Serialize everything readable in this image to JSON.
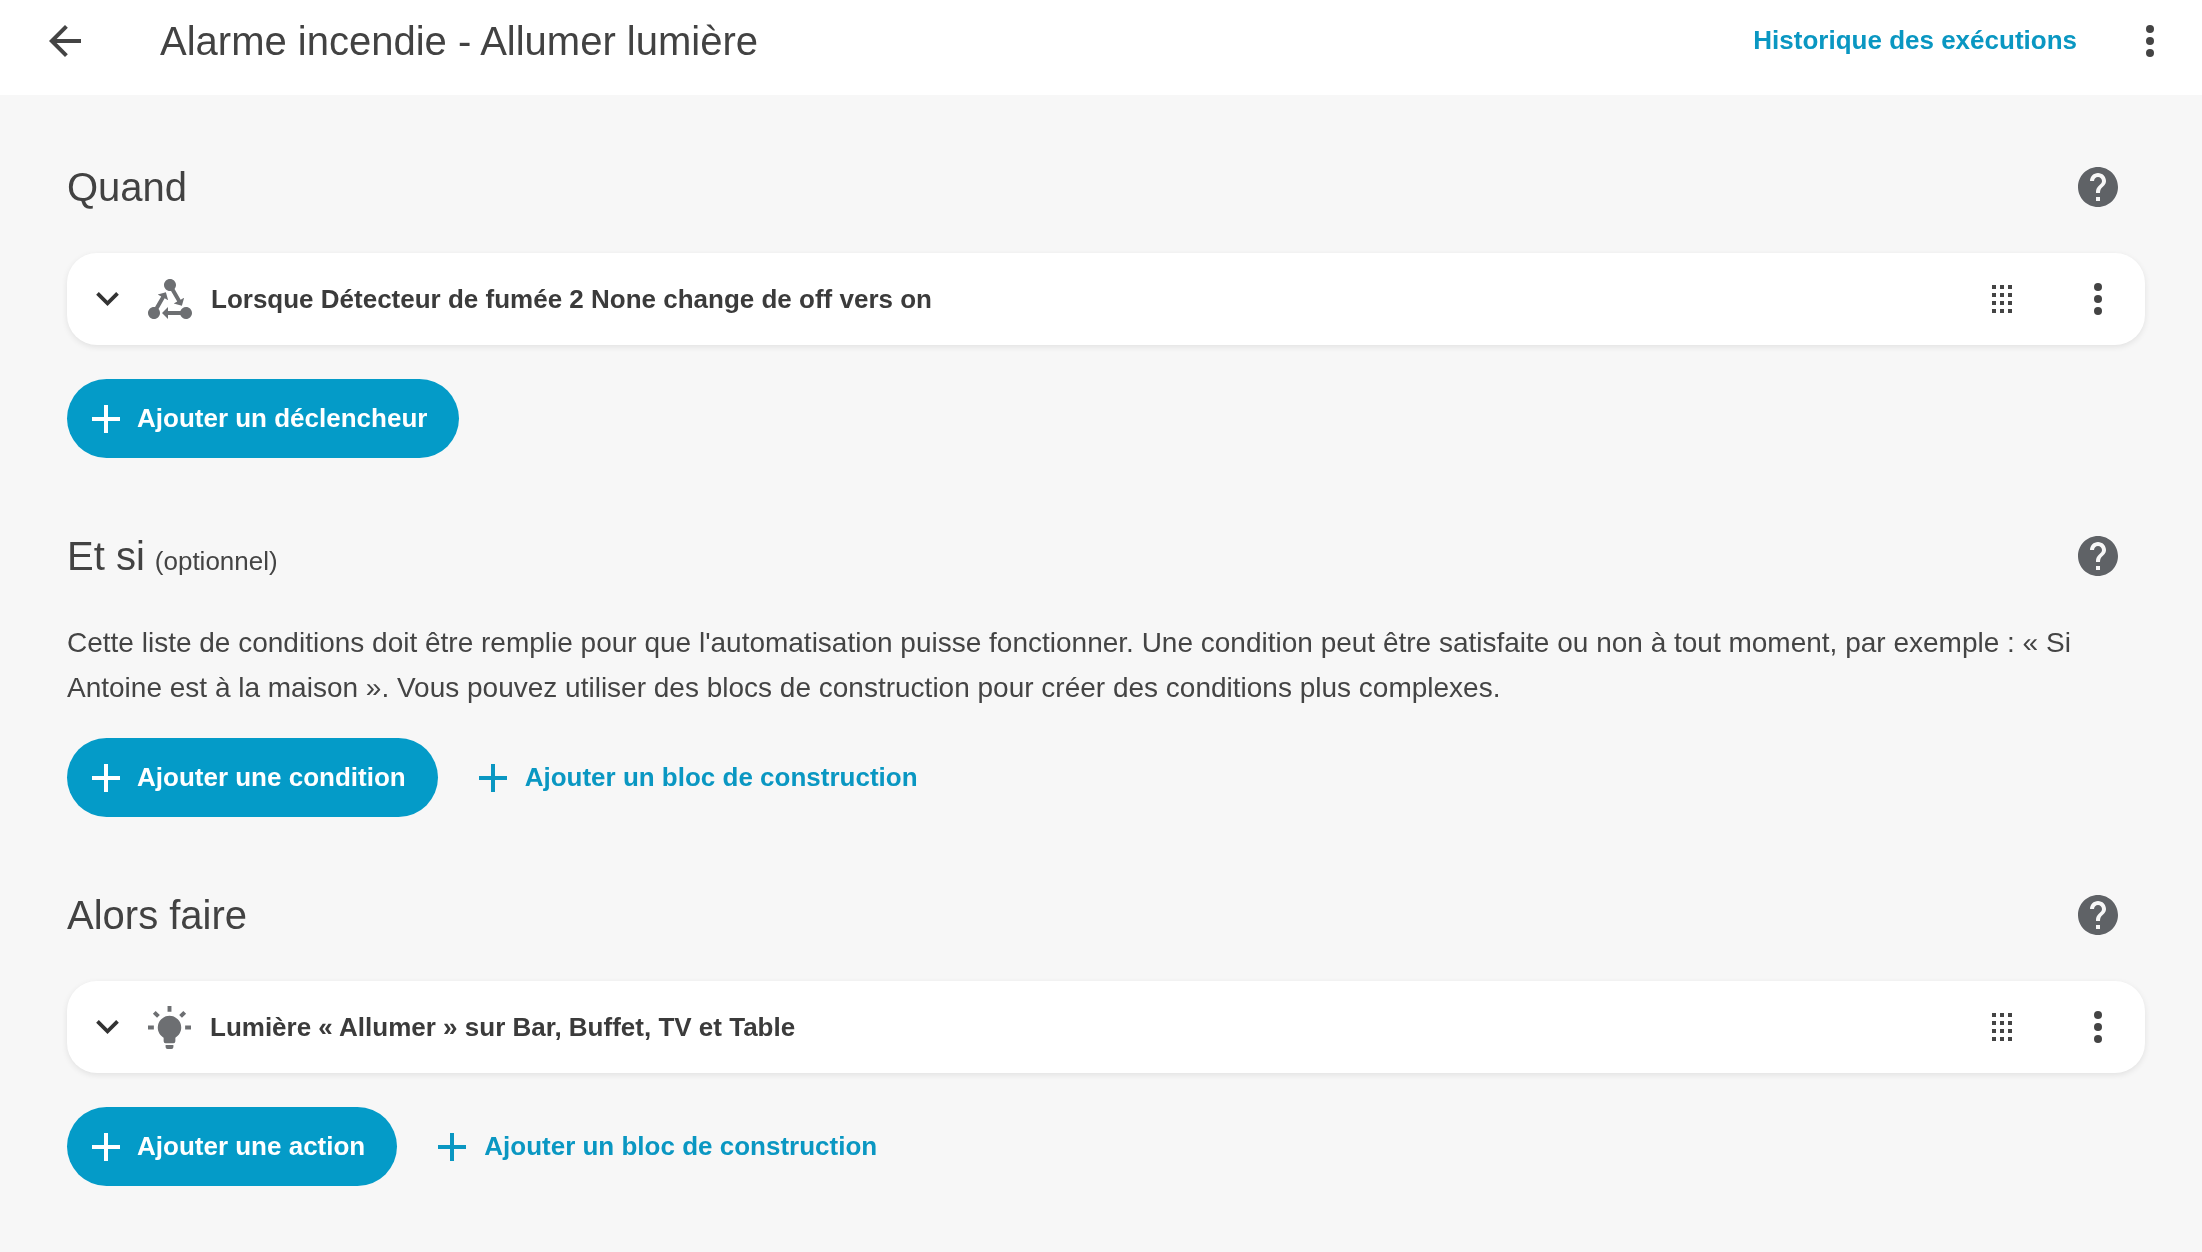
{
  "header": {
    "title": "Alarme incendie - Allumer lumière",
    "history_link": "Historique des exécutions"
  },
  "sections": [
    {
      "title": "Quand",
      "items": [
        {
          "kind": "trigger",
          "text": "Lorsque Détecteur de fumée 2 None change de off vers on",
          "expanded": false
        }
      ],
      "buttons": [
        {
          "kind": "filled",
          "label": "Ajouter un déclencheur"
        }
      ]
    },
    {
      "title": "Et si",
      "note": "(optionnel)",
      "description": "Cette liste de conditions doit être remplie pour que l'automatisation puisse fonctionner. Une condition peut être satisfaite ou non à tout moment, par exemple : « Si Antoine est à la maison ». Vous pouvez utiliser des blocs de construction pour créer des conditions plus complexes.",
      "buttons": [
        {
          "kind": "filled",
          "label": "Ajouter une condition"
        },
        {
          "kind": "text",
          "label": "Ajouter un bloc de construction"
        }
      ]
    },
    {
      "title": "Alors faire",
      "items": [
        {
          "kind": "action",
          "text": "Lumière « Allumer » sur Bar, Buffet, TV et Table",
          "expanded": false
        }
      ],
      "buttons": [
        {
          "kind": "filled",
          "label": "Ajouter une action"
        },
        {
          "kind": "text",
          "label": "Ajouter un bloc de construction"
        }
      ]
    }
  ]
}
